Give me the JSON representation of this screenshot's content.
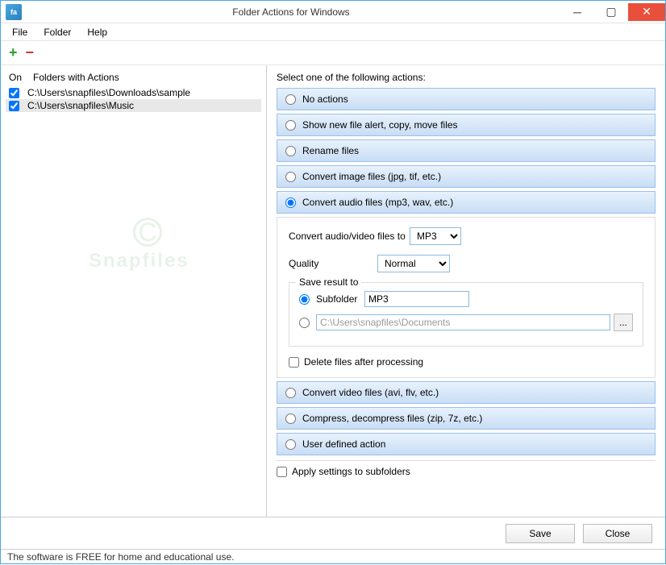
{
  "window": {
    "title": "Folder Actions for Windows",
    "icon_text": "fa"
  },
  "menubar": {
    "file": "File",
    "folder": "Folder",
    "help": "Help"
  },
  "left": {
    "header_on": "On",
    "header_folders": "Folders with Actions",
    "folders": [
      {
        "path": "C:\\Users\\snapfiles\\Downloads\\sample",
        "checked": true,
        "selected": false
      },
      {
        "path": "C:\\Users\\snapfiles\\Music",
        "checked": true,
        "selected": true
      }
    ]
  },
  "right": {
    "section_label": "Select one of the following actions:",
    "actions": {
      "no_actions": "No actions",
      "show_new_file": "Show new file alert, copy, move files",
      "rename": "Rename files",
      "convert_image": "Convert image files (jpg, tif, etc.)",
      "convert_audio": "Convert audio files (mp3, wav, etc.)",
      "convert_video": "Convert video files (avi, flv, etc.)",
      "compress": "Compress, decompress files (zip, 7z, etc.)",
      "user_defined": "User defined action"
    },
    "details": {
      "convert_to_label": "Convert audio/video files to",
      "convert_to_value": "MP3",
      "quality_label": "Quality",
      "quality_value": "Normal",
      "save_legend": "Save result to",
      "subfolder_label": "Subfolder",
      "subfolder_value": "MP3",
      "path_value": "C:\\Users\\snapfiles\\Documents",
      "delete_after": "Delete files after processing"
    },
    "apply_subfolders": "Apply settings to subfolders"
  },
  "buttons": {
    "save": "Save",
    "close": "Close"
  },
  "statusbar": "The software is FREE for home and educational use.",
  "watermark": "Snapfiles"
}
